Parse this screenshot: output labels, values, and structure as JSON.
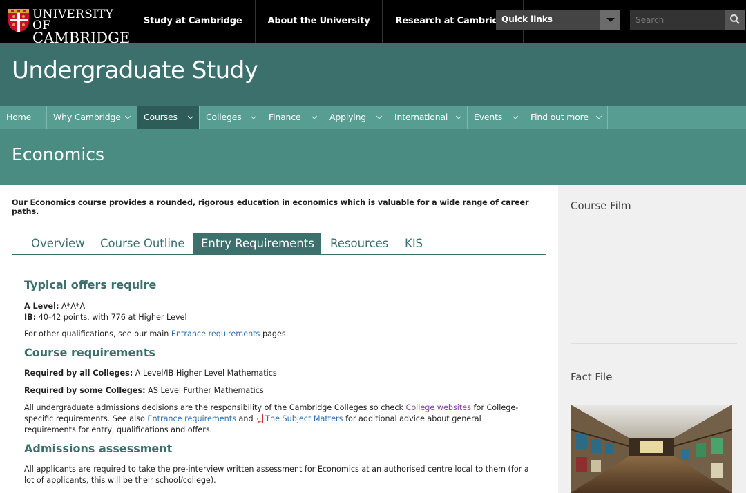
{
  "header": {
    "logo_line1": "UNIVERSITY OF",
    "logo_line2": "CAMBRIDGE",
    "nav": [
      "Study at Cambridge",
      "About the University",
      "Research at Cambridge"
    ],
    "quick_links": "Quick links",
    "search_placeholder": "Search"
  },
  "site_title": "Undergraduate Study",
  "main_nav": {
    "items": [
      {
        "label": "Home"
      },
      {
        "label": "Why Cambridge"
      },
      {
        "label": "Courses"
      },
      {
        "label": "Colleges"
      },
      {
        "label": "Finance"
      },
      {
        "label": "Applying"
      },
      {
        "label": "International"
      },
      {
        "label": "Events"
      },
      {
        "label": "Find out more"
      }
    ],
    "active": "Courses"
  },
  "page_title": "Economics",
  "intro": "Our Economics course provides a rounded, rigorous education in economics which is valuable for a wide range of career paths.",
  "tabs": {
    "items": [
      "Overview",
      "Course Outline",
      "Entry Requirements",
      "Resources",
      "KIS"
    ],
    "active": "Entry Requirements"
  },
  "typical_offers": {
    "heading": "Typical offers require",
    "a_level_label": "A Level:",
    "a_level_value": "A*A*A",
    "ib_label": "IB:",
    "ib_value": "40-42 points, with 776 at Higher Level",
    "other_pre": "For other qualifications, see our main",
    "other_link": "Entrance requirements",
    "other_post": "pages."
  },
  "course_requirements": {
    "heading": "Course requirements",
    "all_label": "Required by all Colleges:",
    "all_value": "A Level/IB Higher Level Mathematics",
    "some_label": "Required by some Colleges:",
    "some_value": "AS Level Further Mathematics",
    "para_1": "All undergraduate admissions decisions are the responsibility of the Cambridge Colleges so check",
    "college_link": "College websites",
    "para_2": "for College-specific requirements. See also",
    "entrance_link": "Entrance requirements",
    "para_3": "and",
    "subject_link": "The Subject Matters",
    "para_4": "for additional advice about general requirements for entry, qualifications and offers."
  },
  "admissions": {
    "heading": "Admissions assessment",
    "text": "All applicants are required to take the pre-interview written assessment for Economics at an authorised centre local to them (for a lot of applicants, this will be their school/college)."
  },
  "sidebar": {
    "course_film": "Course Film",
    "fact_file": "Fact File"
  },
  "colors": {
    "top": "#000000",
    "site_band": "#3b706c",
    "main_nav": "#579d92",
    "nav_active": "#2e5c58",
    "page_band": "#4a8b82",
    "link": "#2a72b5",
    "visited_link": "#8a3da6"
  },
  "icons": [
    "cambridge-crest-icon",
    "dropdown-arrow-icon",
    "search-icon",
    "chevron-down-icon",
    "pdf-icon"
  ]
}
